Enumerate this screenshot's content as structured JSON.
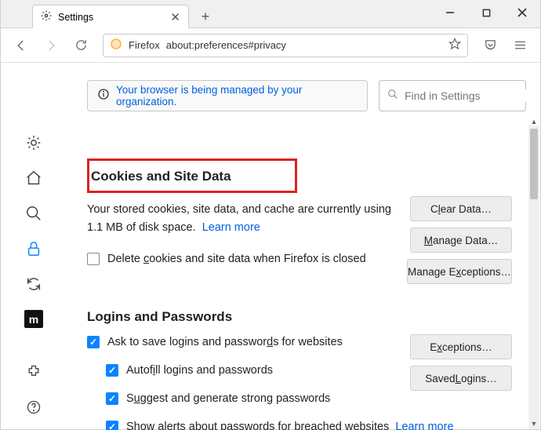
{
  "tab": {
    "title": "Settings"
  },
  "urlbar": {
    "brand": "Firefox",
    "address": "about:preferences#privacy"
  },
  "banner": "Your browser is being managed by your organization.",
  "search": {
    "placeholder": "Find in Settings"
  },
  "cookies": {
    "title": "Cookies and Site Data",
    "usage": "Your stored cookies, site data, and cache are currently using 1.1 MB of disk space.",
    "learn": "Learn more",
    "delete_label": "Delete cookies and site data when Firefox is closed",
    "buttons": {
      "clear": "Clear Data…",
      "manage": "Manage Data…",
      "exceptions": "Manage Exceptions…"
    }
  },
  "logins": {
    "title": "Logins and Passwords",
    "ask": "Ask to save logins and passwords for websites",
    "autofill": "Autofill logins and passwords",
    "suggest": "Suggest and generate strong passwords",
    "breached": "Show alerts about passwords for breached websites",
    "learn": "Learn more",
    "buttons": {
      "exceptions": "Exceptions…",
      "saved": "Saved Logins…"
    }
  }
}
